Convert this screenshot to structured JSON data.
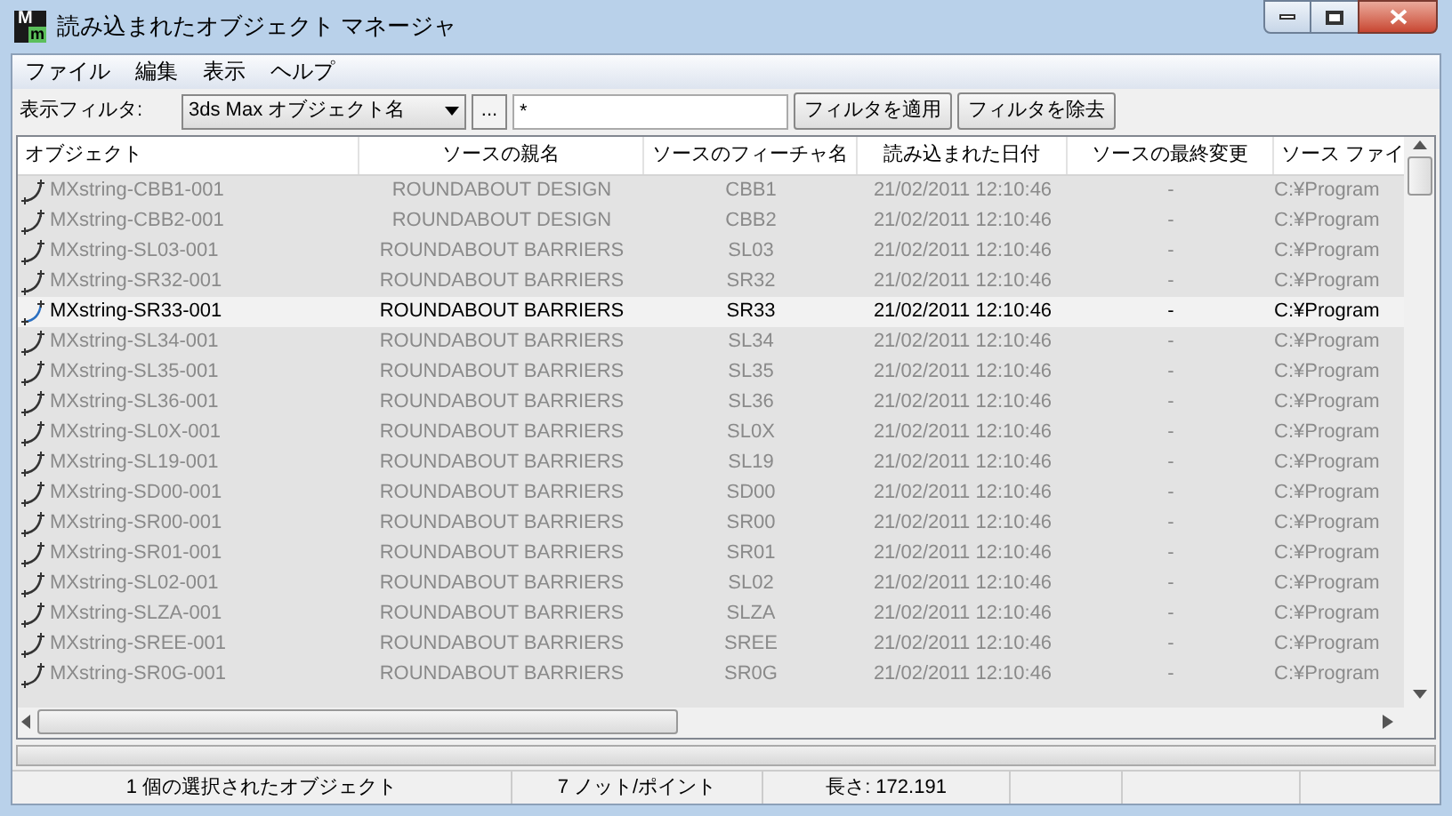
{
  "window": {
    "title": "読み込まれたオブジェクト マネージャ",
    "logo_top": "M",
    "logo_bottom": "m"
  },
  "menu": [
    "ファイル",
    "編集",
    "表示",
    "ヘルプ"
  ],
  "toolbar": {
    "filter_label": "表示フィルタ:",
    "filter_select": "3ds Max オブジェクト名",
    "browse_button": "...",
    "filter_value": "*",
    "buttons": [
      "フィルタを適用",
      "フィルタを除去"
    ]
  },
  "table": {
    "columns": [
      "オブジェクト",
      "ソースの親名",
      "ソースのフィーチャ名",
      "読み込まれた日付",
      "ソースの最終変更",
      "ソース ファイ"
    ],
    "rows": [
      {
        "object": "MXstring-CBB1-001",
        "parent": "ROUNDABOUT DESIGN",
        "feature": "CBB1",
        "date": "21/02/2011 12:10:46",
        "modified": "-",
        "file": "C:¥Program",
        "selected": false
      },
      {
        "object": "MXstring-CBB2-001",
        "parent": "ROUNDABOUT DESIGN",
        "feature": "CBB2",
        "date": "21/02/2011 12:10:46",
        "modified": "-",
        "file": "C:¥Program",
        "selected": false
      },
      {
        "object": "MXstring-SL03-001",
        "parent": "ROUNDABOUT BARRIERS",
        "feature": "SL03",
        "date": "21/02/2011 12:10:46",
        "modified": "-",
        "file": "C:¥Program",
        "selected": false
      },
      {
        "object": "MXstring-SR32-001",
        "parent": "ROUNDABOUT BARRIERS",
        "feature": "SR32",
        "date": "21/02/2011 12:10:46",
        "modified": "-",
        "file": "C:¥Program",
        "selected": false
      },
      {
        "object": "MXstring-SR33-001",
        "parent": "ROUNDABOUT BARRIERS",
        "feature": "SR33",
        "date": "21/02/2011 12:10:46",
        "modified": "-",
        "file": "C:¥Program",
        "selected": true
      },
      {
        "object": "MXstring-SL34-001",
        "parent": "ROUNDABOUT BARRIERS",
        "feature": "SL34",
        "date": "21/02/2011 12:10:46",
        "modified": "-",
        "file": "C:¥Program",
        "selected": false
      },
      {
        "object": "MXstring-SL35-001",
        "parent": "ROUNDABOUT BARRIERS",
        "feature": "SL35",
        "date": "21/02/2011 12:10:46",
        "modified": "-",
        "file": "C:¥Program",
        "selected": false
      },
      {
        "object": "MXstring-SL36-001",
        "parent": "ROUNDABOUT BARRIERS",
        "feature": "SL36",
        "date": "21/02/2011 12:10:46",
        "modified": "-",
        "file": "C:¥Program",
        "selected": false
      },
      {
        "object": "MXstring-SL0X-001",
        "parent": "ROUNDABOUT BARRIERS",
        "feature": "SL0X",
        "date": "21/02/2011 12:10:46",
        "modified": "-",
        "file": "C:¥Program",
        "selected": false
      },
      {
        "object": "MXstring-SL19-001",
        "parent": "ROUNDABOUT BARRIERS",
        "feature": "SL19",
        "date": "21/02/2011 12:10:46",
        "modified": "-",
        "file": "C:¥Program",
        "selected": false
      },
      {
        "object": "MXstring-SD00-001",
        "parent": "ROUNDABOUT BARRIERS",
        "feature": "SD00",
        "date": "21/02/2011 12:10:46",
        "modified": "-",
        "file": "C:¥Program",
        "selected": false
      },
      {
        "object": "MXstring-SR00-001",
        "parent": "ROUNDABOUT BARRIERS",
        "feature": "SR00",
        "date": "21/02/2011 12:10:46",
        "modified": "-",
        "file": "C:¥Program",
        "selected": false
      },
      {
        "object": "MXstring-SR01-001",
        "parent": "ROUNDABOUT BARRIERS",
        "feature": "SR01",
        "date": "21/02/2011 12:10:46",
        "modified": "-",
        "file": "C:¥Program",
        "selected": false
      },
      {
        "object": "MXstring-SL02-001",
        "parent": "ROUNDABOUT BARRIERS",
        "feature": "SL02",
        "date": "21/02/2011 12:10:46",
        "modified": "-",
        "file": "C:¥Program",
        "selected": false
      },
      {
        "object": "MXstring-SLZA-001",
        "parent": "ROUNDABOUT BARRIERS",
        "feature": "SLZA",
        "date": "21/02/2011 12:10:46",
        "modified": "-",
        "file": "C:¥Program",
        "selected": false
      },
      {
        "object": "MXstring-SREE-001",
        "parent": "ROUNDABOUT BARRIERS",
        "feature": "SREE",
        "date": "21/02/2011 12:10:46",
        "modified": "-",
        "file": "C:¥Program",
        "selected": false
      },
      {
        "object": "MXstring-SR0G-001",
        "parent": "ROUNDABOUT BARRIERS",
        "feature": "SR0G",
        "date": "21/02/2011 12:10:46",
        "modified": "-",
        "file": "C:¥Program",
        "selected": false
      }
    ]
  },
  "progress": {
    "level": 0
  },
  "status_bar": [
    "1 個の選択されたオブジェクト",
    "7 ノット/ポイント",
    "長さ: 172.191"
  ]
}
